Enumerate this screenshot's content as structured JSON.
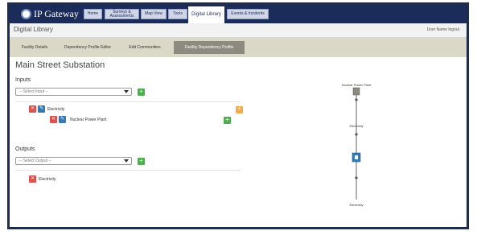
{
  "colors": {
    "nav_bg": "#1c2c5a",
    "tab_bar": "#dcd8c8",
    "active_tab": "#8d8b80",
    "add": "#4cae4c",
    "delete": "#d9534f",
    "edit": "#337ab7",
    "alt": "#f0ad4e"
  },
  "nav": {
    "logo": "IP Gateway",
    "items": [
      {
        "label": "Home"
      },
      {
        "label": "Surveys & Assessments"
      },
      {
        "label": "Map View"
      },
      {
        "label": "Tools"
      },
      {
        "label": "Digital Library"
      },
      {
        "label": "Events & Incidents"
      }
    ]
  },
  "header": {
    "title": "Digital Library",
    "user": "User Name logout"
  },
  "tabs": [
    {
      "label": "Facility Details"
    },
    {
      "label": "Dependency Profile Editor"
    },
    {
      "label": "Edit Communities"
    },
    {
      "label": "Facility Dependency Profile"
    }
  ],
  "page": {
    "title": "Main Street Substation"
  },
  "inputs": {
    "label": "Inputs",
    "placeholder": "-- Select Input --",
    "items": [
      {
        "label": "Electricity"
      },
      {
        "label": "Nuclear Power Plant"
      }
    ]
  },
  "outputs": {
    "label": "Outputs",
    "placeholder": "-- Select Output --",
    "items": [
      {
        "label": "Electricity"
      }
    ]
  },
  "diagram": {
    "nodes": [
      {
        "label": "Nuclear Power Plant"
      },
      {
        "label": "Electricity"
      },
      {
        "label": "Electricity"
      }
    ]
  }
}
